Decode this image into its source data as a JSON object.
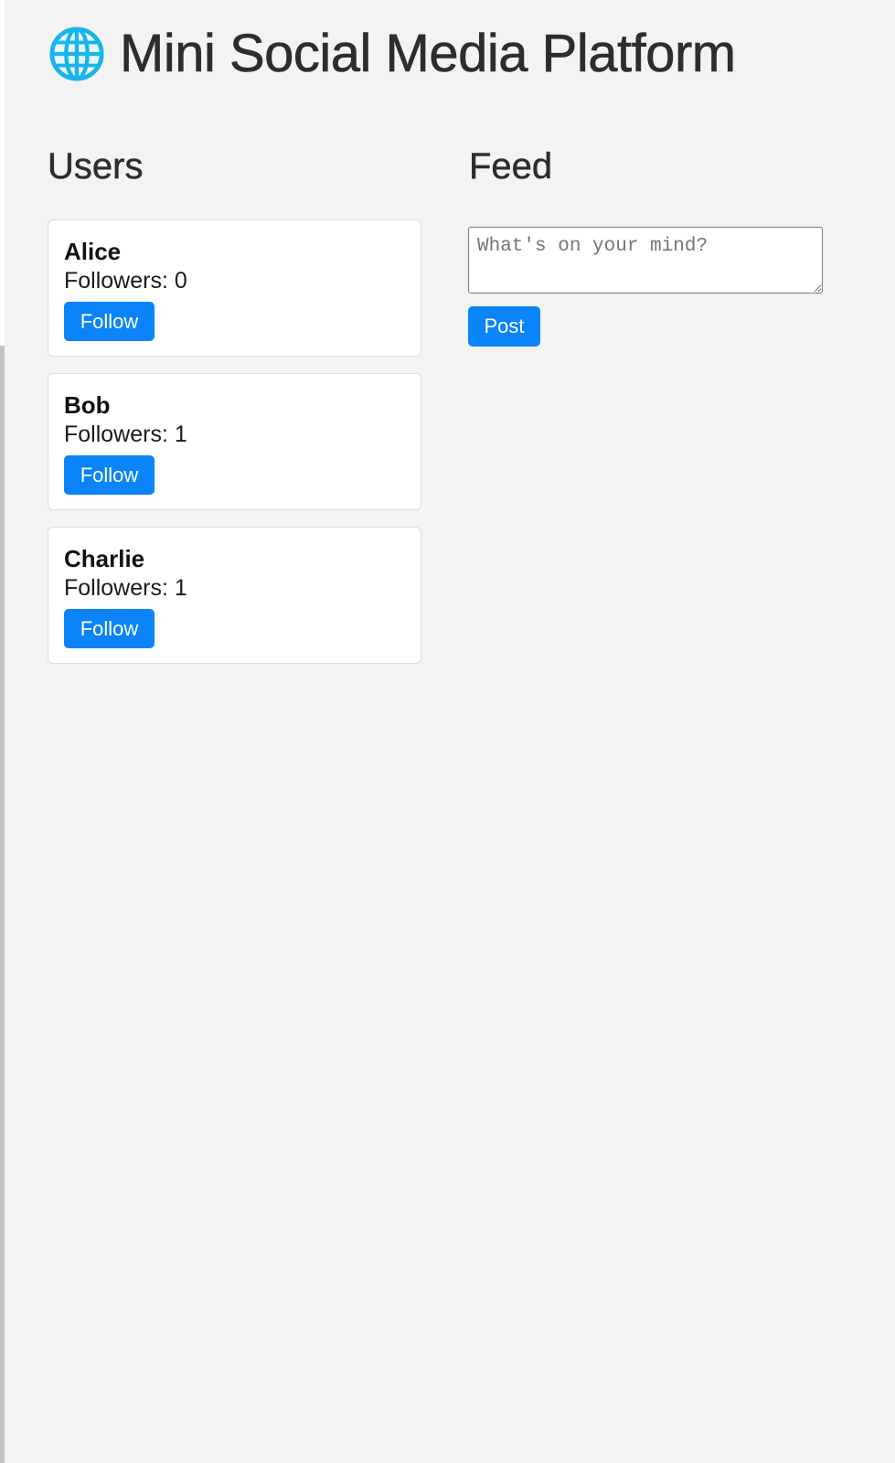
{
  "app": {
    "title": "Mini Social Media Platform",
    "icon": "globe-icon",
    "accent_color": "#0a84f8"
  },
  "users_section": {
    "heading": "Users",
    "users": [
      {
        "name": "Alice",
        "followers_label": "Followers: 0",
        "followers": 0,
        "follow_label": "Follow"
      },
      {
        "name": "Bob",
        "followers_label": "Followers: 1",
        "followers": 1,
        "follow_label": "Follow"
      },
      {
        "name": "Charlie",
        "followers_label": "Followers: 1",
        "followers": 1,
        "follow_label": "Follow"
      }
    ]
  },
  "feed_section": {
    "heading": "Feed",
    "composer": {
      "placeholder": "What's on your mind?",
      "value": ""
    },
    "post_label": "Post"
  }
}
